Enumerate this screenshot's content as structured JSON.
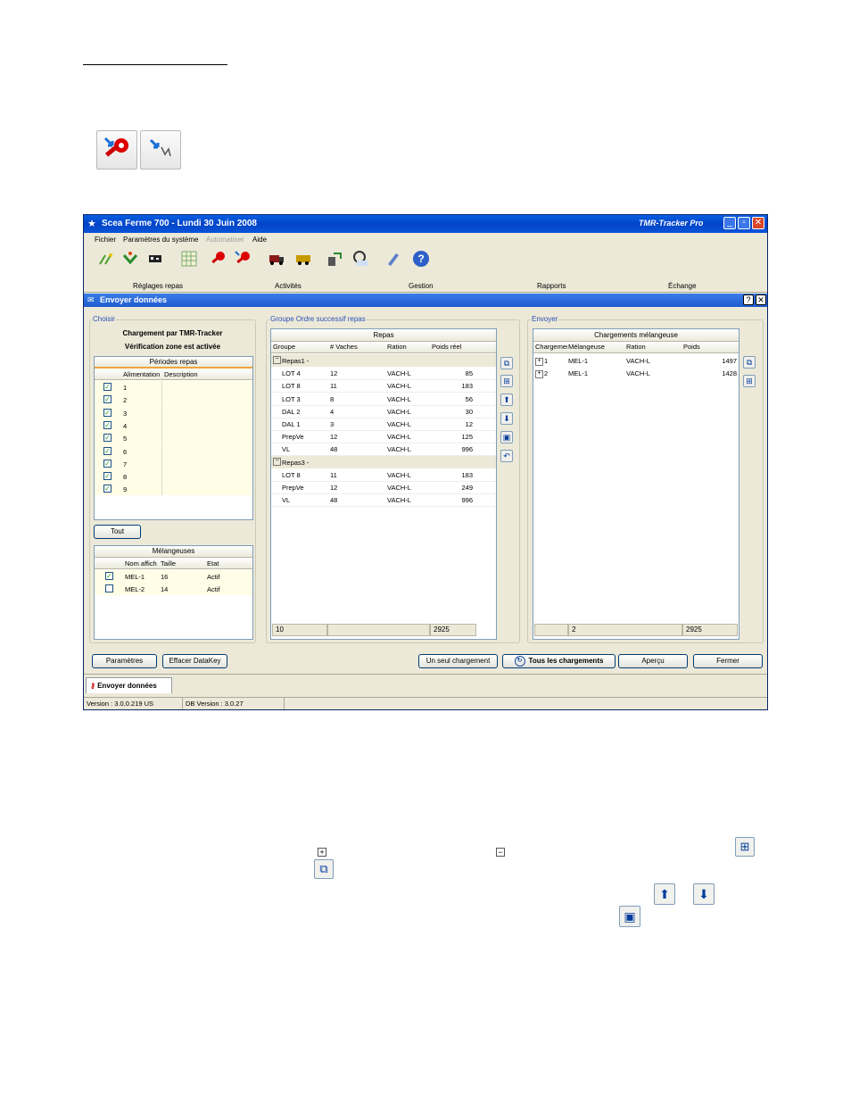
{
  "window": {
    "title": "Scea Ferme 700 - Lundi 30 Juin 2008",
    "brand": "TMR-Tracker Pro"
  },
  "menu": [
    "Fichier",
    "Paramètres du système",
    "Automatiser",
    "Aide"
  ],
  "categories": [
    "Réglages repas",
    "Activités",
    "Gestion",
    "Rapports",
    "Échange"
  ],
  "subwindow": {
    "title": "Envoyer données"
  },
  "choisir": {
    "label": "Choisir",
    "line1": "Chargement par TMR-Tracker",
    "line2": "Vérification zone est activée",
    "periods_title": "Périodes repas",
    "col_alim": "Alimentation",
    "col_desc": "Description",
    "periods": [
      "1",
      "2",
      "3",
      "4",
      "5",
      "6",
      "7",
      "8",
      "9"
    ],
    "tout_button": "Tout",
    "mixers_title": "Mélangeuses",
    "mix_col_name": "Nom affich",
    "mix_col_size": "Taille",
    "mix_col_state": "Etat",
    "mixers": [
      {
        "name": "MEL-1",
        "size": "16",
        "state": "Actif",
        "checked": true
      },
      {
        "name": "MEL-2",
        "size": "14",
        "state": "Actif",
        "checked": false
      }
    ]
  },
  "groupe": {
    "label": "Groupe Ordre successif repas",
    "header": "Repas",
    "cols": [
      "Groupe",
      "# Vaches",
      "Ration",
      "Poids réel"
    ],
    "sections": [
      {
        "name": "Repas1 -",
        "rows": [
          [
            "LOT 4",
            "12",
            "VACH-L",
            "85"
          ],
          [
            "LOT 8",
            "11",
            "VACH-L",
            "183"
          ],
          [
            "LOT 3",
            "8",
            "VACH-L",
            "56"
          ],
          [
            "DAL 2",
            "4",
            "VACH-L",
            "30"
          ],
          [
            "DAL 1",
            "3",
            "VACH-L",
            "12"
          ],
          [
            "PrepVe",
            "12",
            "VACH-L",
            "125"
          ],
          [
            "VL",
            "48",
            "VACH-L",
            "996"
          ]
        ]
      },
      {
        "name": "Repas3 -",
        "rows": [
          [
            "LOT 8",
            "11",
            "VACH-L",
            "183"
          ],
          [
            "PrepVe",
            "12",
            "VACH-L",
            "249"
          ],
          [
            "VL",
            "48",
            "VACH-L",
            "996"
          ]
        ]
      }
    ],
    "footer_count": "10",
    "footer_total": "2925"
  },
  "envoyer": {
    "label": "Envoyer",
    "header": "Chargements mélangeuse",
    "cols": [
      "Chargement",
      "Mélangeuse",
      "Ration",
      "Poids"
    ],
    "rows": [
      [
        "1",
        "MEL-1",
        "VACH-L",
        "1497"
      ],
      [
        "2",
        "MEL-1",
        "VACH-L",
        "1428"
      ]
    ],
    "footer_count": "2",
    "footer_total": "2925"
  },
  "buttons": {
    "parametres": "Paramètres",
    "effacer": "Effacer DataKey",
    "un_seul": "Un seul chargement",
    "tous": "Tous les chargements",
    "apercu": "Aperçu",
    "fermer": "Fermer"
  },
  "tab": {
    "label": "Envoyer données"
  },
  "status": {
    "version": "Version : 3.0.0.219 US",
    "db_version": "DB Version : 3.0.27"
  }
}
